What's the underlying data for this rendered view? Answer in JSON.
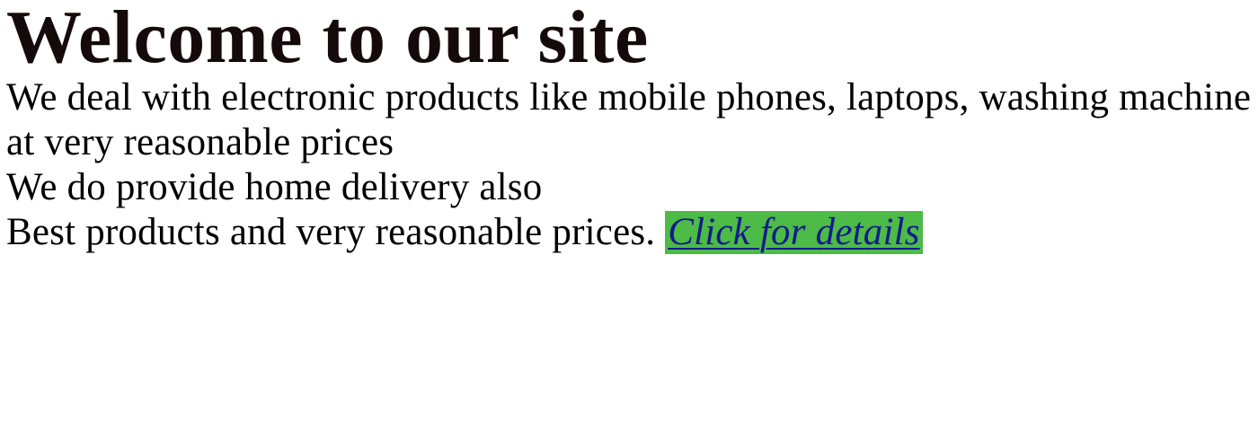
{
  "page": {
    "heading": "Welcome to our site",
    "paragraphs": {
      "products": "We deal with electronic products like mobile phones, laptops, washing machine at very reasonable prices",
      "delivery": "We do provide home delivery also",
      "best_prefix": "Best products and very reasonable prices."
    },
    "link": {
      "label": "Click for details",
      "background_color": "#4cbb47",
      "text_color": "#141b8c"
    }
  }
}
